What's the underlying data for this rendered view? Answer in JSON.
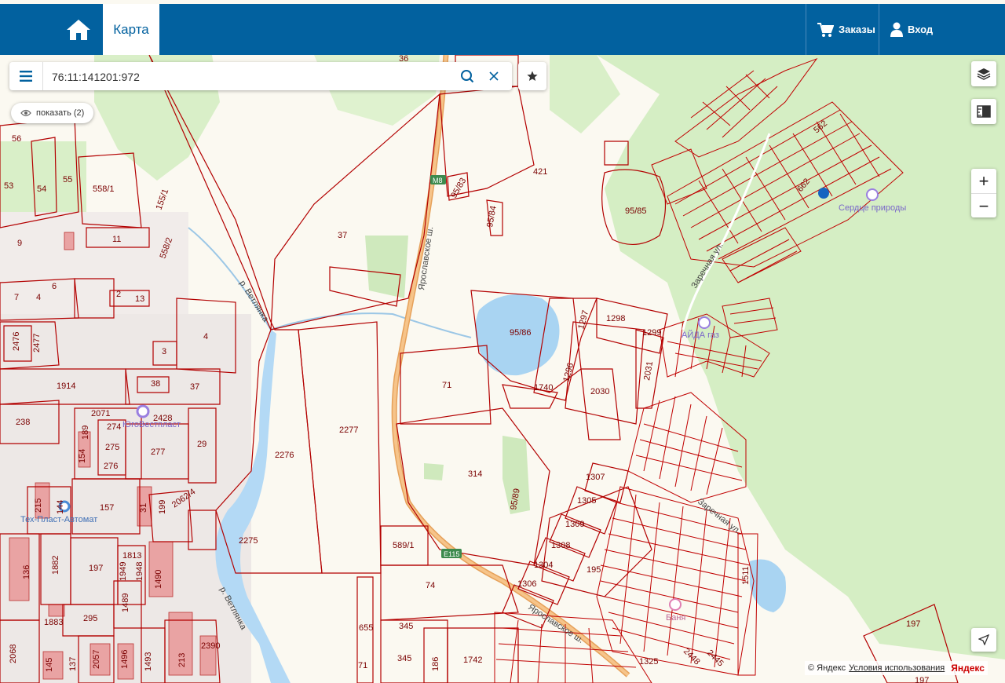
{
  "nav": {
    "tab_label": "Карта",
    "orders_label": "Заказы",
    "login_label": "Вход"
  },
  "search": {
    "value": "76:11:141201:972"
  },
  "show_button": {
    "label": "показать (2)"
  },
  "zoom": {
    "plus": "+",
    "minus": "−"
  },
  "attribution": {
    "copyright": "© Яндекс",
    "terms": "Условия использования",
    "brand": "Яндекс"
  },
  "map": {
    "pois": [
      "Сердце природы",
      "АЙДА газ",
      "ЮгоВестпласт",
      "Тех-Пласт-Автомат",
      "Баня"
    ],
    "roads": [
      "Ярославское ш.",
      "Ярославское ш.",
      "р. Ветлянка",
      "р. Ветлянка",
      "Заречная ул.",
      "Заречная ул."
    ],
    "route_badges": [
      "M8",
      "E115"
    ],
    "parcels": [
      "36",
      "56",
      "53",
      "54",
      "55",
      "558/1",
      "155/1",
      "558/2",
      "9",
      "11",
      "6",
      "7",
      "4",
      "2",
      "13",
      "37",
      "4",
      "3",
      "2476",
      "2477",
      "1914",
      "38",
      "37",
      "238",
      "2071",
      "274",
      "2428",
      "275",
      "189",
      "154",
      "277",
      "29",
      "276",
      "157",
      "215",
      "144",
      "31",
      "199",
      "2062/4",
      "136",
      "1882",
      "197",
      "1813",
      "1949",
      "1948",
      "1490",
      "1489",
      "1883",
      "295",
      "2068",
      "145",
      "137",
      "2057",
      "1496",
      "1493",
      "213",
      "2390",
      "95/83",
      "95/84",
      "421",
      "95/85",
      "562",
      "662",
      "95/86",
      "1297",
      "1298",
      "1299",
      "2031",
      "71",
      "1740",
      "1296",
      "2030",
      "2277",
      "2276",
      "314",
      "95/89",
      "2275",
      "589/1",
      "1307",
      "1305",
      "1309",
      "1308",
      "1304",
      "1306",
      "195",
      "74",
      "655",
      "345",
      "345",
      "186",
      "1742",
      "71",
      "1511",
      "2448",
      "2445",
      "1325",
      "197",
      "197"
    ]
  }
}
